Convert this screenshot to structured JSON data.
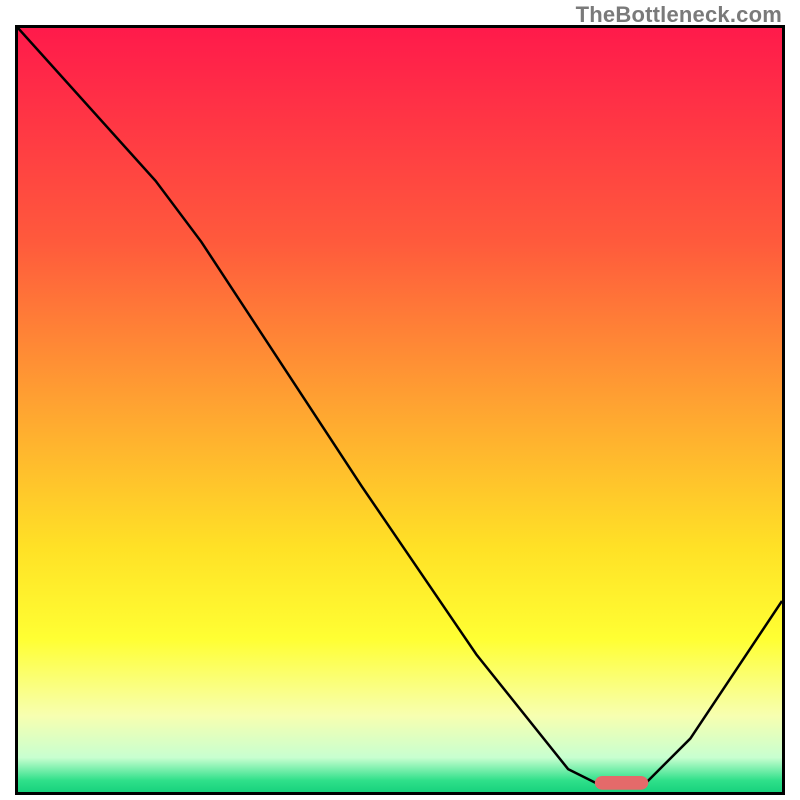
{
  "watermark": "TheBottleneck.com",
  "chart_data": {
    "type": "line",
    "title": "",
    "xlabel": "",
    "ylabel": "",
    "xlim": [
      0,
      100
    ],
    "ylim": [
      0,
      100
    ],
    "gradient_stops": [
      {
        "offset": 0.0,
        "color": "#ff1a4b"
      },
      {
        "offset": 0.28,
        "color": "#ff5a3c"
      },
      {
        "offset": 0.5,
        "color": "#ffa531"
      },
      {
        "offset": 0.68,
        "color": "#ffe126"
      },
      {
        "offset": 0.8,
        "color": "#ffff33"
      },
      {
        "offset": 0.9,
        "color": "#f7ffb0"
      },
      {
        "offset": 0.955,
        "color": "#c8ffd0"
      },
      {
        "offset": 0.985,
        "color": "#2fe08a"
      },
      {
        "offset": 1.0,
        "color": "#18d27d"
      }
    ],
    "series": [
      {
        "name": "bottleneck-curve",
        "color": "#000000",
        "width": 2.5,
        "points": [
          {
            "x": 0,
            "y": 100
          },
          {
            "x": 18,
            "y": 80
          },
          {
            "x": 24,
            "y": 72
          },
          {
            "x": 45,
            "y": 40
          },
          {
            "x": 60,
            "y": 18
          },
          {
            "x": 72,
            "y": 3
          },
          {
            "x": 76,
            "y": 1
          },
          {
            "x": 82,
            "y": 1
          },
          {
            "x": 88,
            "y": 7
          },
          {
            "x": 100,
            "y": 25
          }
        ]
      }
    ],
    "marker": {
      "name": "optimal-range",
      "color": "#e46a6a",
      "x0": 75.5,
      "x1": 82.5,
      "y": 1.2,
      "thickness": 1.8,
      "radius": 1.0
    }
  }
}
